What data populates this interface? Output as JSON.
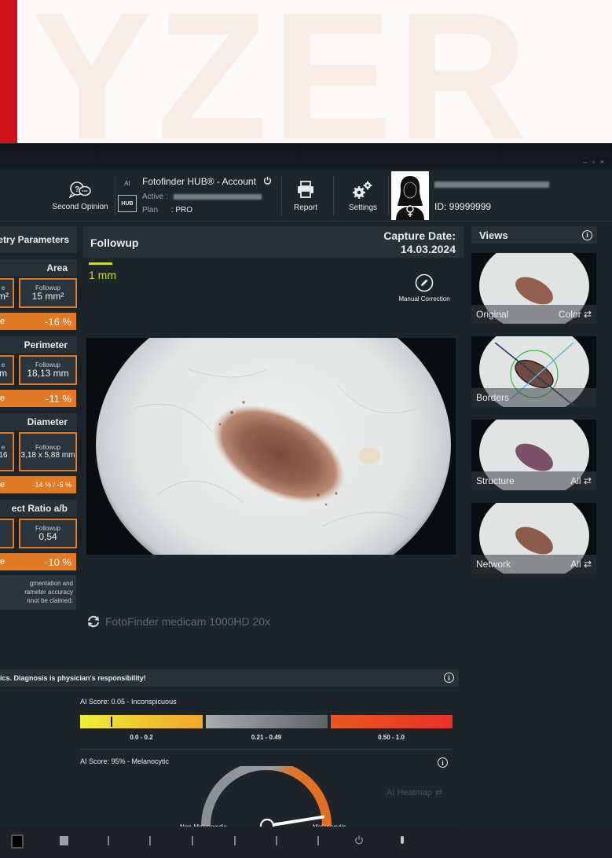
{
  "banner": {
    "text": "YZER"
  },
  "titlebar": {
    "window_controls": "– ▫ ×"
  },
  "topbar": {
    "second_opinion_label": "Second Opinion",
    "account": {
      "ai_label": "AI",
      "hub_label": "HUB",
      "title": "Fotofinder HUB® - Account",
      "active_label": "Active :",
      "plan_label": "Plan",
      "plan_value": ": PRO"
    },
    "report_label": "Report",
    "settings_label": "Settings",
    "patient_id": "ID: 99999999"
  },
  "left_panel": {
    "header": "etry Parameters",
    "area": {
      "title": "Area",
      "baseline_label": "e",
      "baseline_value": "m²",
      "followup_label": "Followup",
      "followup_value": "15 mm²",
      "change_label": "e",
      "change_value": "-16 %"
    },
    "perimeter": {
      "title": "Perimeter",
      "baseline_label": "e",
      "baseline_value": "m",
      "followup_label": "Followup",
      "followup_value": "18,13 mm",
      "change_label": "e",
      "change_value": "-11 %"
    },
    "diameter": {
      "title": "Diameter",
      "baseline_label": "e",
      "baseline_value": "16",
      "followup_label": "Followup",
      "followup_value": "3,18 x 5,88 mm",
      "change_label": "e",
      "change_value": "-14 % / -5 %"
    },
    "aspect": {
      "title": "ect Ratio a/b",
      "followup_label": "Followup",
      "followup_value": "0,54",
      "change_label": "e",
      "change_value": "-10 %"
    },
    "note_lines": [
      "gmentation and",
      "rameter accuracy",
      "nnot be claimed."
    ]
  },
  "center": {
    "title": "Followup",
    "capture_label": "Capture Date:",
    "capture_date": "14.03.2024",
    "scale_label": "1 mm",
    "manual_correction_label": "Manual Correction",
    "device_label": "FotoFinder medicam 1000HD 20x"
  },
  "views": {
    "title": "Views",
    "items": [
      {
        "name": "Original",
        "mode": "Color"
      },
      {
        "name": "Borders",
        "mode": ""
      },
      {
        "name": "Structure",
        "mode": "All"
      },
      {
        "name": "Network",
        "mode": "All"
      }
    ]
  },
  "disclaimer": "ics. Diagnosis is physician's responsibility!",
  "ai_panel": {
    "score1_label": "AI Score: 0.05 - Inconspicuous",
    "score1_value": 0.05,
    "ranges": [
      "0.0 - 0.2",
      "0.21 - 0.49",
      "0.50 - 1.0"
    ],
    "score2_label": "AI Score: 95% - Melanocytic",
    "score2_percent": 95,
    "gauge_left_label": "Non-Melanocytic",
    "gauge_right_label": "Melanocytic",
    "heatmap_label": "AI Heatmap"
  },
  "colors": {
    "accent_orange": "#e07a26",
    "scale_green": "#c7dc2e",
    "panel_dark": "#1d252b",
    "header": "#27313a"
  }
}
